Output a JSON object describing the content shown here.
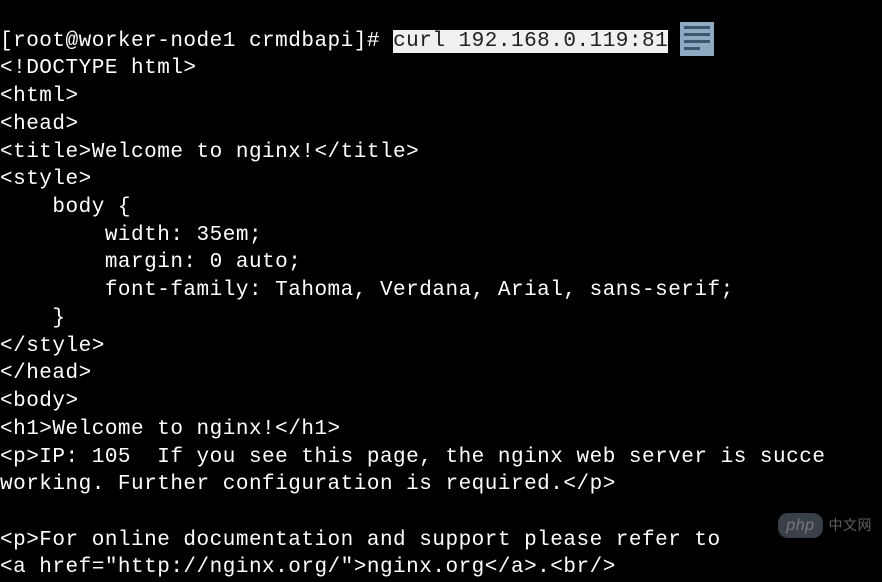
{
  "terminal": {
    "prompt": "[root@worker-node1 crmdbapi]# ",
    "command": "curl 192.168.0.119:81",
    "output": {
      "l1": "<!DOCTYPE html>",
      "l2": "<html>",
      "l3": "<head>",
      "l4": "<title>Welcome to nginx!</title>",
      "l5": "<style>",
      "l6": "    body {",
      "l7": "        width: 35em;",
      "l8": "        margin: 0 auto;",
      "l9": "        font-family: Tahoma, Verdana, Arial, sans-serif;",
      "l10": "    }",
      "l11": "</style>",
      "l12": "</head>",
      "l13": "<body>",
      "l14": "<h1>Welcome to nginx!</h1>",
      "l15": "<p>IP: 105  If you see this page, the nginx web server is succe",
      "l16": "working. Further configuration is required.</p>",
      "l17": "",
      "l18": "<p>For online documentation and support please refer to",
      "l19": "<a href=\"http://nginx.org/\">nginx.org</a>.<br/>"
    }
  },
  "watermark": {
    "badge": "php",
    "text": "中文网"
  }
}
